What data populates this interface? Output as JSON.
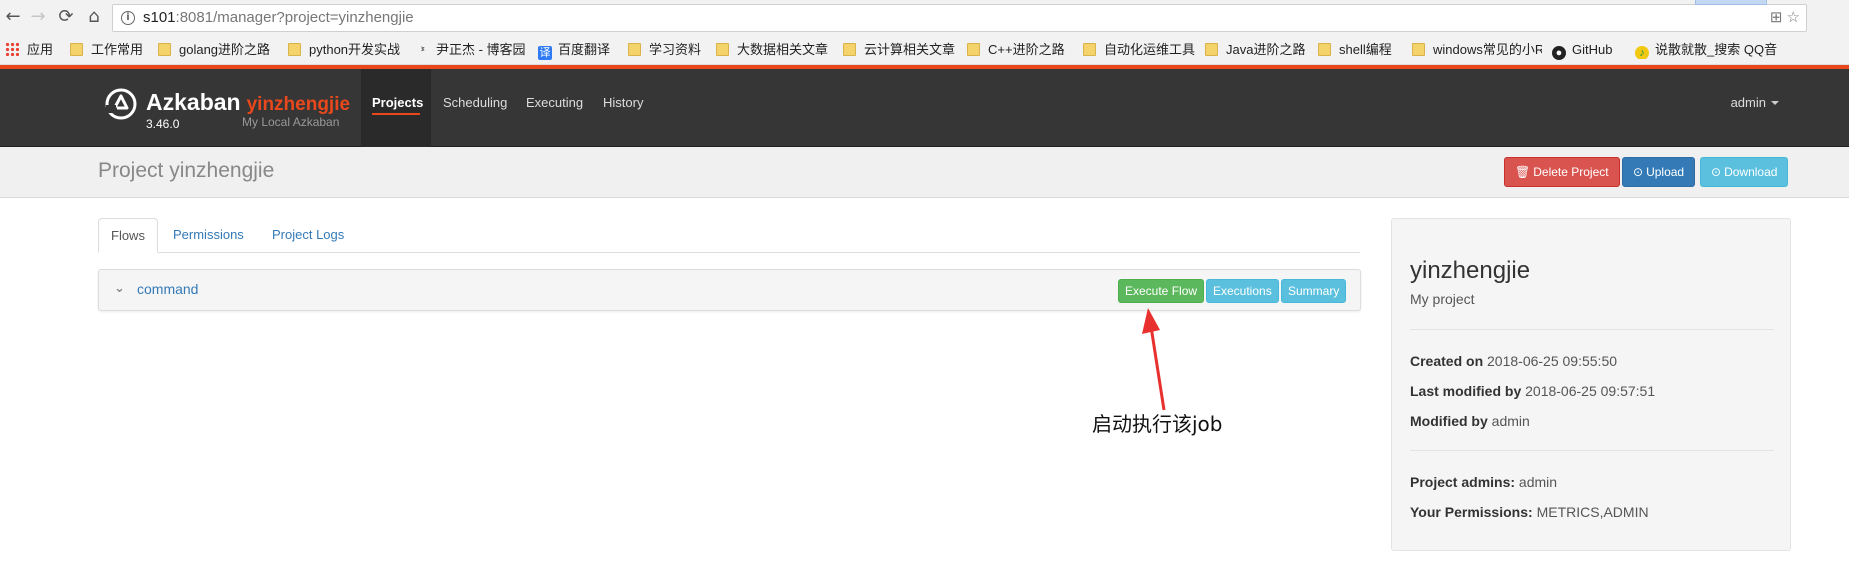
{
  "browser": {
    "nav": {
      "back": "←",
      "forward": "→",
      "reload": "⟳",
      "home": "⌂"
    },
    "url": {
      "host": "s101",
      "rest": ":8081/manager?project=yinzhengjie"
    },
    "url_right_icons": "⊞ ☆",
    "bookmarks": [
      {
        "label": "应用",
        "icon": "apps"
      },
      {
        "label": "工作常用",
        "icon": "folder"
      },
      {
        "label": "golang进阶之路",
        "icon": "folder"
      },
      {
        "label": "python开发实战",
        "icon": "folder"
      },
      {
        "label": "尹正杰 - 博客园",
        "icon": "fav-cnblogs"
      },
      {
        "label": "百度翻译",
        "icon": "fav-translate"
      },
      {
        "label": "学习资料",
        "icon": "folder"
      },
      {
        "label": "大数据相关文章",
        "icon": "folder"
      },
      {
        "label": "云计算相关文章",
        "icon": "folder"
      },
      {
        "label": "C++进阶之路",
        "icon": "folder"
      },
      {
        "label": "自动化运维工具",
        "icon": "folder"
      },
      {
        "label": "Java进阶之路",
        "icon": "folder"
      },
      {
        "label": "shell编程",
        "icon": "folder"
      },
      {
        "label": "windows常见的小R",
        "icon": "folder"
      },
      {
        "label": "GitHub",
        "icon": "github"
      },
      {
        "label": "说散就散_搜索 QQ音",
        "icon": "fav-qq"
      }
    ]
  },
  "header": {
    "brand": "Azkaban",
    "project_label": "yinzhengjie",
    "version": "3.46.0",
    "subtitle": "My Local Azkaban",
    "nav": [
      {
        "label": "Projects",
        "active": true
      },
      {
        "label": "Scheduling",
        "active": false
      },
      {
        "label": "Executing",
        "active": false
      },
      {
        "label": "History",
        "active": false
      }
    ],
    "user": "admin"
  },
  "project_bar": {
    "title": "Project yinzhengjie",
    "buttons": {
      "delete": "Delete Project",
      "upload": "Upload",
      "download": "Download"
    }
  },
  "tabs": [
    {
      "label": "Flows",
      "active": true
    },
    {
      "label": "Permissions",
      "active": false
    },
    {
      "label": "Project Logs",
      "active": false
    }
  ],
  "flow": {
    "name": "command",
    "buttons": {
      "execute": "Execute Flow",
      "executions": "Executions",
      "summary": "Summary"
    }
  },
  "annotation": {
    "text": "启动执行该job",
    "color": "#e8302f"
  },
  "info_panel": {
    "name": "yinzhengjie",
    "description": "My project",
    "created_label": "Created on",
    "created_value": "2018-06-25 09:55:50",
    "modified_label": "Last modified by",
    "modified_value": "2018-06-25 09:57:51",
    "modified_by_label": "Modified by",
    "modified_by_value": "admin",
    "admins_label": "Project admins:",
    "admins_value": "admin",
    "permissions_label": "Your Permissions:",
    "permissions_value": "METRICS,ADMIN"
  },
  "colors": {
    "accent": "#e8481c",
    "header_bg": "#363636",
    "link": "#337ab7",
    "danger": "#d9534f",
    "primary": "#337ab7",
    "info": "#5bc0de",
    "success": "#5cb85c"
  }
}
